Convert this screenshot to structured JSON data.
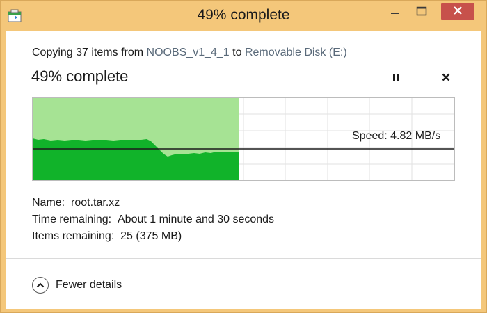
{
  "window": {
    "title": "49% complete",
    "accent_color": "#f4c77a",
    "close_color": "#c7514b",
    "icons": {
      "app": "file-copy-icon",
      "minimize": "minimize-icon",
      "maximize": "maximize-icon",
      "close": "close-icon"
    }
  },
  "copy": {
    "prefix": "Copying 37 items from ",
    "source": "NOOBS_v1_4_1",
    "middle": " to ",
    "destination": "Removable Disk (E:)",
    "progress_title": "49% complete",
    "percent": 49
  },
  "controls": {
    "pause_icon": "pause-icon",
    "cancel_icon": "cancel-icon"
  },
  "graph": {
    "speed_label": "Speed: 4.82 MB/s",
    "fill_color": "#11b32a",
    "done_color": "#a6e394"
  },
  "details": {
    "name_label": "Name:",
    "name_value": "root.tar.xz",
    "time_label": "Time remaining:",
    "time_value": "About 1 minute and 30 seconds",
    "items_label": "Items remaining:",
    "items_value": "25 (375 MB)"
  },
  "footer": {
    "fewer_details_label": "Fewer details",
    "fewer_icon": "chevron-up-icon"
  }
}
